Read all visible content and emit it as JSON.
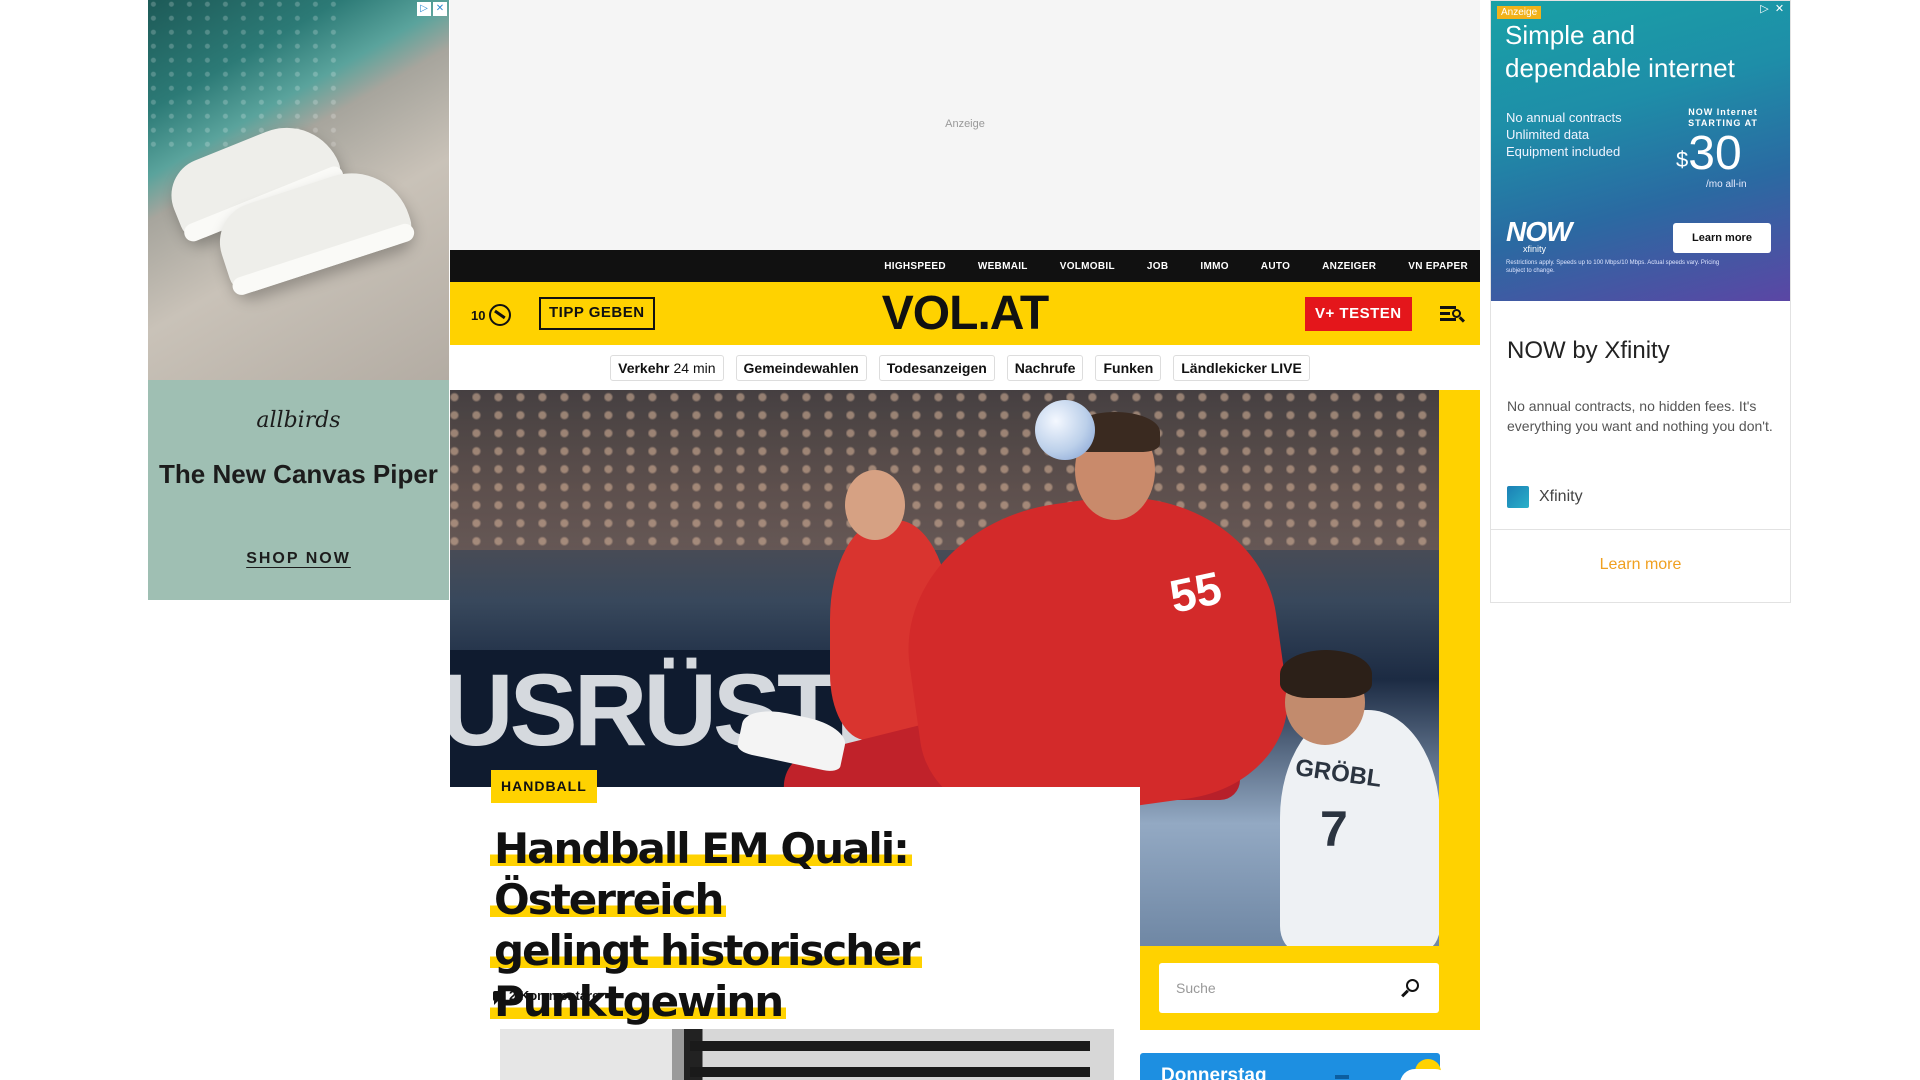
{
  "left_ad": {
    "brand": "allbirds",
    "headline": "The New Canvas Piper",
    "cta": "SHOP NOW"
  },
  "top_ad": {
    "label": "Anzeige"
  },
  "top_nav": {
    "items": [
      "HIGHSPEED",
      "WEBMAIL",
      "VOLMOBIL",
      "JOB",
      "IMMO",
      "AUTO",
      "ANZEIGER",
      "VN EPAPER"
    ]
  },
  "header": {
    "temperature": "10",
    "tipp_label": "TIPP GEBEN",
    "logo": "VOL.AT",
    "vplus_label": "V+ TESTEN",
    "colors": {
      "yellow": "#ffd200",
      "red": "#e4161b",
      "black": "#111111"
    }
  },
  "chips": {
    "traffic_label": "Verkehr",
    "traffic_value": "24 min",
    "items": [
      "Gemeindewahlen",
      "Todesanzeigen",
      "Nachrufe",
      "Funken",
      "Ländlekicker LIVE"
    ]
  },
  "hero": {
    "banner_text": "USRÜSTER",
    "main_player_number": "55",
    "opponent_name": "GRÖBL",
    "opponent_number": "7"
  },
  "article": {
    "category": "HANDBALL",
    "title_lines": [
      "Handball EM Quali: Österreich",
      "gelingt historischer",
      "Punktgewinn"
    ],
    "comments": "2 Kommentare"
  },
  "search": {
    "placeholder": "Suche"
  },
  "weather_widget": {
    "day": "Donnerstag"
  },
  "right_ad": {
    "badge": "Anzeige",
    "headline": "Simple and dependable internet",
    "features": [
      "No annual contracts",
      "Unlimited data",
      "Equipment included"
    ],
    "starting_label": "NOW Internet STARTING AT",
    "price_currency": "$",
    "price": "30",
    "price_suffix": "/mo all-in",
    "brand_logo": "NOW",
    "brand_sub": "xfinity",
    "button": "Learn more",
    "fine_print": "Restrictions apply. Speeds up to 100 Mbps/10 Mbps. Actual speeds vary. Pricing subject to change.",
    "ad_title": "NOW by Xfinity",
    "ad_text": "No annual contracts, no hidden fees. It's everything you want and nothing you don't.",
    "advertiser": "Xfinity",
    "cta": "Learn more"
  }
}
